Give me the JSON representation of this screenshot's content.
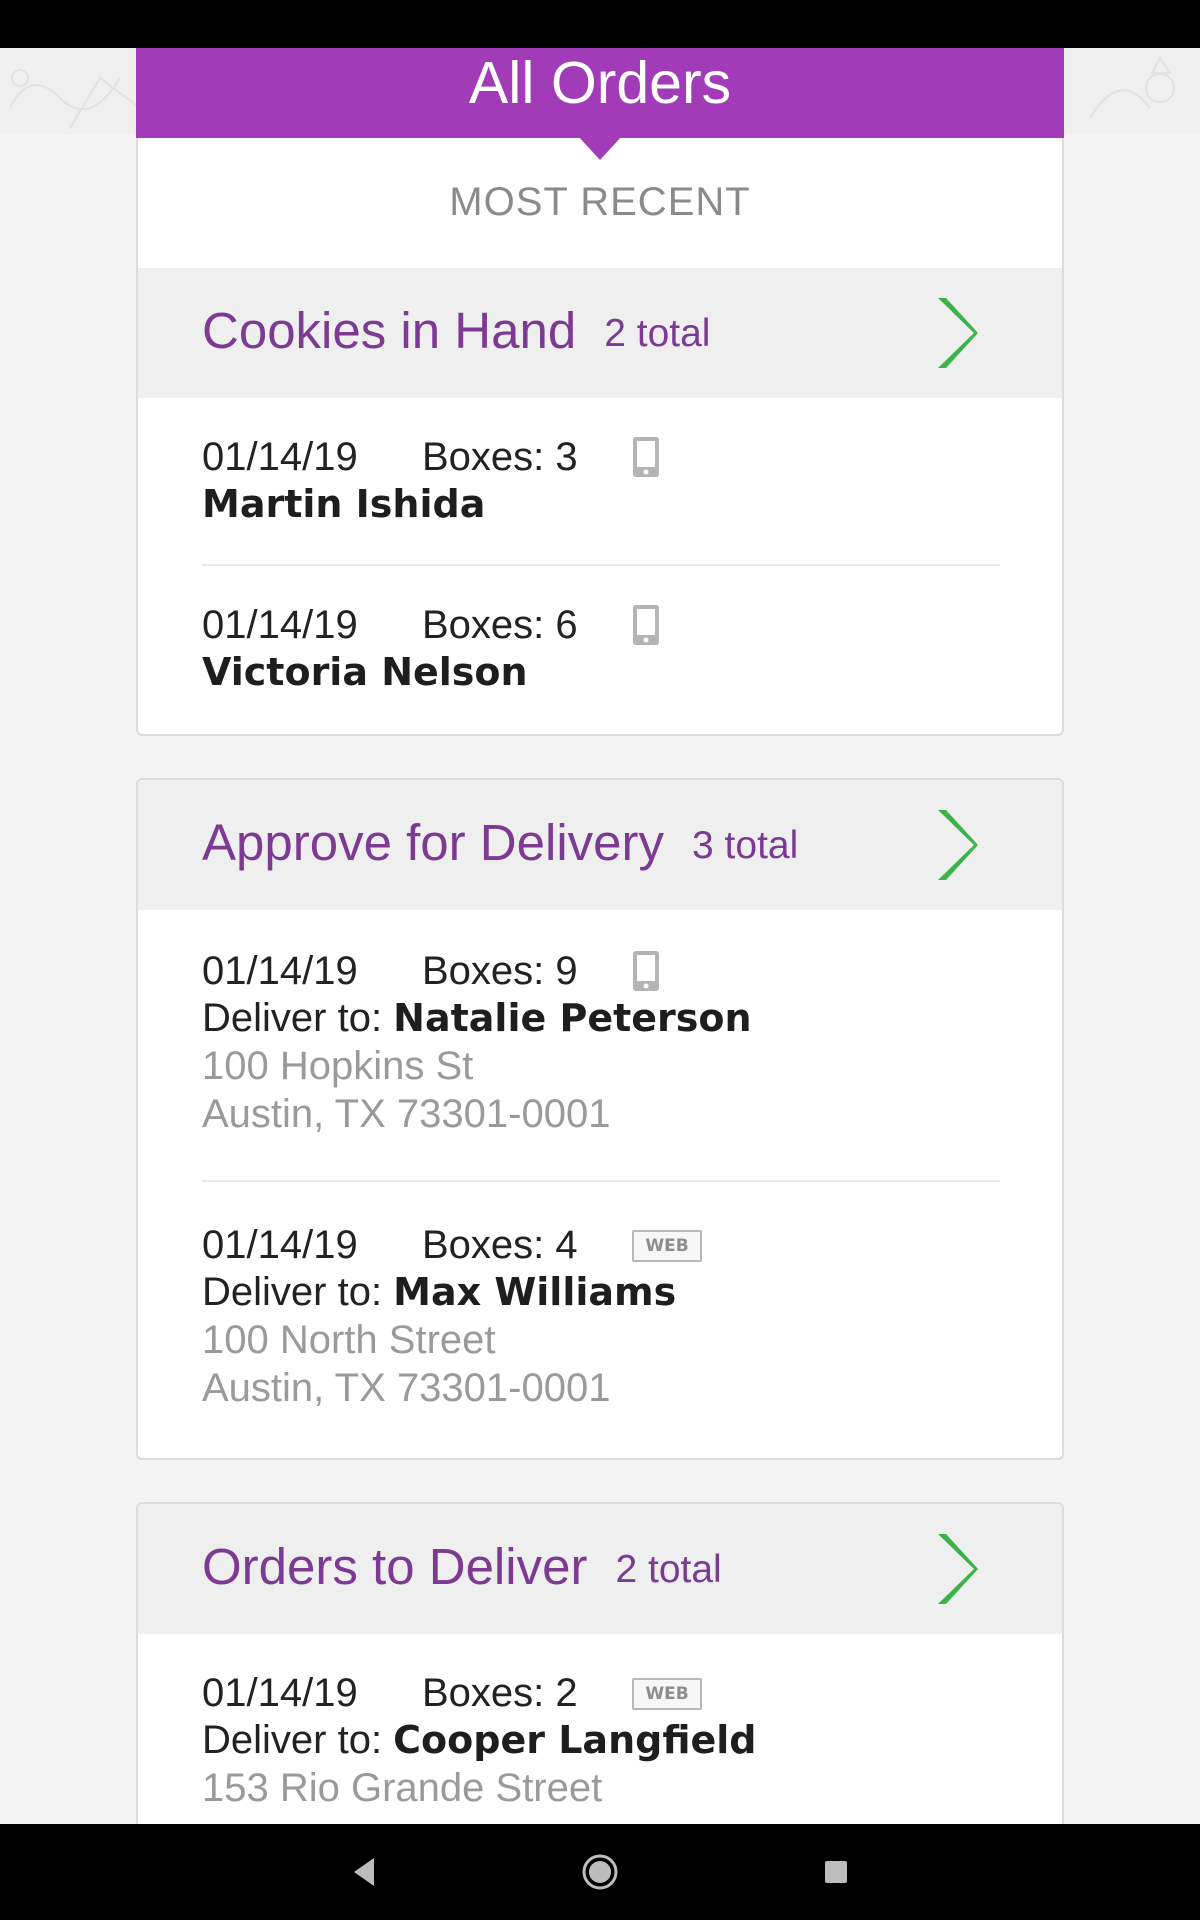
{
  "header": {
    "title": "All Orders",
    "subtitle": "MOST RECENT"
  },
  "colors": {
    "brand": "#a23bb8",
    "section_title": "#7c3a93",
    "chevron": "#3bb34a"
  },
  "sections": [
    {
      "title": "Cookies in Hand",
      "count": "2 total",
      "orders": [
        {
          "date": "01/14/19",
          "boxes": "Boxes: 3",
          "source": "phone-icon",
          "customer": "Martin Ishida"
        },
        {
          "date": "01/14/19",
          "boxes": "Boxes: 6",
          "source": "phone-icon",
          "customer": "Victoria Nelson"
        }
      ]
    },
    {
      "title": "Approve for Delivery",
      "count": "3 total",
      "orders": [
        {
          "date": "01/14/19",
          "boxes": "Boxes: 9",
          "source": "phone-icon",
          "deliver_label": "Deliver to: ",
          "customer": "Natalie Peterson",
          "address1": "100 Hopkins St",
          "address2": "Austin, TX 73301-0001"
        },
        {
          "date": "01/14/19",
          "boxes": "Boxes: 4",
          "source": "web-icon",
          "source_label": "WEB",
          "deliver_label": "Deliver to: ",
          "customer": "Max Williams",
          "address1": "100 North Street",
          "address2": "Austin, TX 73301-0001"
        }
      ]
    },
    {
      "title": "Orders to Deliver",
      "count": "2 total",
      "orders": [
        {
          "date": "01/14/19",
          "boxes": "Boxes: 2",
          "source": "web-icon",
          "source_label": "WEB",
          "deliver_label": "Deliver to: ",
          "customer": "Cooper Langfield",
          "address1": "153 Rio Grande Street"
        }
      ]
    }
  ],
  "nav": {
    "back": "back-icon",
    "home": "home-icon",
    "recents": "recents-icon"
  }
}
